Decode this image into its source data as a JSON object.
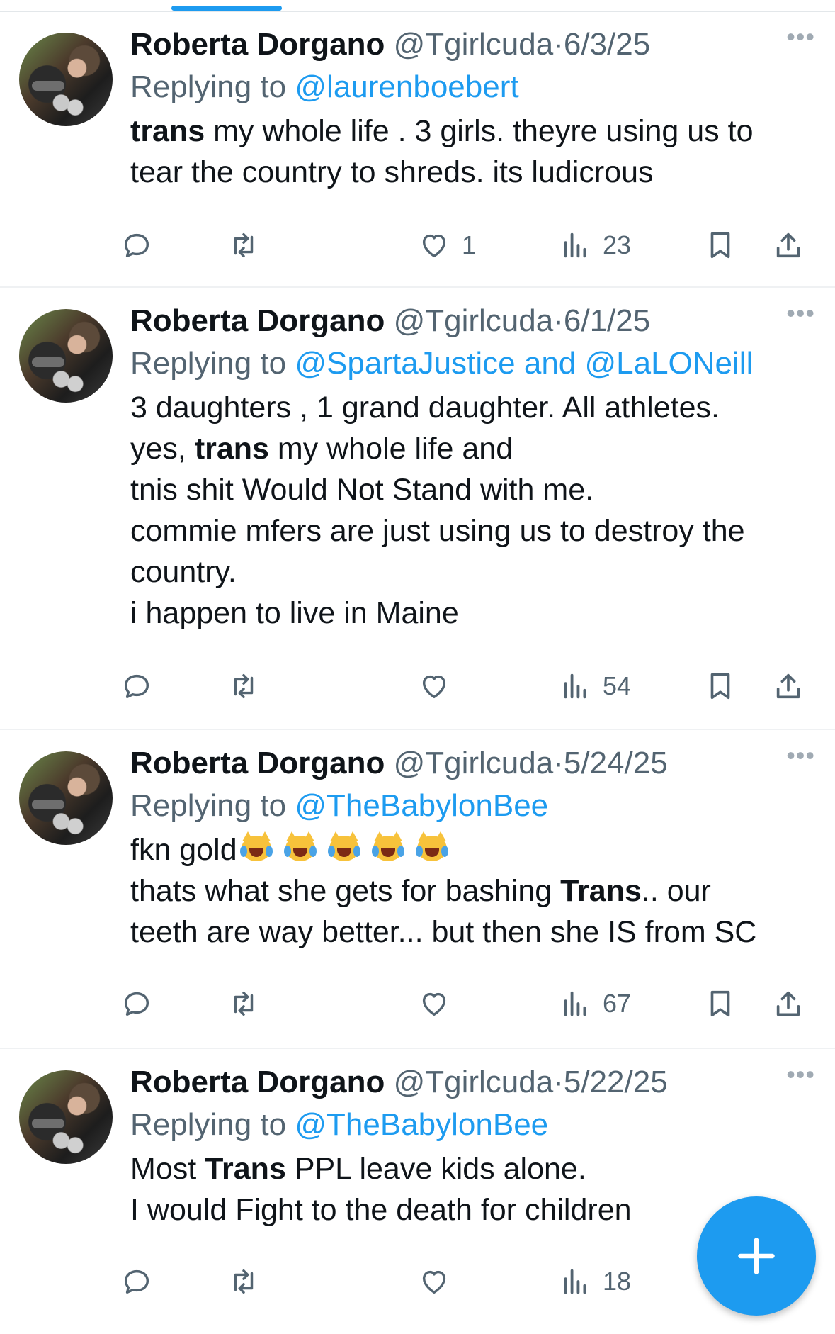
{
  "tweets": [
    {
      "name": "Roberta Dorgano",
      "handle": "@Tgirlcuda",
      "sep": "·",
      "date": "6/3/25",
      "reply_prefix": "Replying to",
      "reply_to": "@laurenboebert",
      "lines": [
        [
          {
            "t": "trans",
            "b": true
          },
          {
            "t": " my whole life . 3 girls. theyre using us to",
            "b": false
          }
        ],
        [
          {
            "t": "tear the country to shreds. its ludicrous",
            "b": false
          }
        ]
      ],
      "likes": "1",
      "views": "23"
    },
    {
      "name": "Roberta Dorgano",
      "handle": "@Tgirlcuda",
      "sep": "·",
      "date": "6/1/25",
      "reply_prefix": "Replying to",
      "reply_to": "@SpartaJustice and @LaLONeill",
      "lines": [
        [
          {
            "t": "3 daughters , 1 grand daughter. All athletes.",
            "b": false
          }
        ],
        [
          {
            "t": "yes, ",
            "b": false
          },
          {
            "t": "trans",
            "b": true
          },
          {
            "t": " my whole life and",
            "b": false
          }
        ],
        [
          {
            "t": "tnis shit Would Not Stand with me.",
            "b": false
          }
        ],
        [
          {
            "t": "commie mfers are just using us to destroy the",
            "b": false
          }
        ],
        [
          {
            "t": "country.",
            "b": false
          }
        ],
        [
          {
            "t": "i happen to live in Maine",
            "b": false
          }
        ]
      ],
      "likes": "",
      "views": "54"
    },
    {
      "name": "Roberta Dorgano",
      "handle": "@Tgirlcuda",
      "sep": "·",
      "date": "5/24/25",
      "reply_prefix": "Replying to",
      "reply_to": "@TheBabylonBee",
      "lines": [
        [
          {
            "t": "fkn gold",
            "b": false,
            "emoji": "joy-cat",
            "emoji_count": 5
          }
        ],
        [
          {
            "t": "thats what she gets for bashing ",
            "b": false
          },
          {
            "t": "Trans",
            "b": true
          },
          {
            "t": ".. our",
            "b": false
          }
        ],
        [
          {
            "t": "teeth are way better... but then she IS from SC",
            "b": false
          }
        ]
      ],
      "likes": "",
      "views": "67"
    },
    {
      "name": "Roberta Dorgano",
      "handle": "@Tgirlcuda",
      "sep": "·",
      "date": "5/22/25",
      "reply_prefix": "Replying to",
      "reply_to": "@TheBabylonBee",
      "lines": [
        [
          {
            "t": "Most ",
            "b": false
          },
          {
            "t": "Trans",
            "b": true
          },
          {
            "t": " PPL leave kids alone.",
            "b": false
          }
        ],
        [
          {
            "t": "I would Fight to the death for children",
            "b": false
          }
        ]
      ],
      "likes": "",
      "views": "18"
    }
  ],
  "more_label": "•••",
  "icons": {
    "reply": "reply-icon",
    "retweet": "retweet-icon",
    "like": "like-icon",
    "views": "views-icon",
    "bookmark": "bookmark-icon",
    "share": "share-icon",
    "compose": "plus-icon"
  },
  "colors": {
    "accent": "#1d9bf0",
    "muted": "#536471",
    "text": "#0f1419"
  }
}
